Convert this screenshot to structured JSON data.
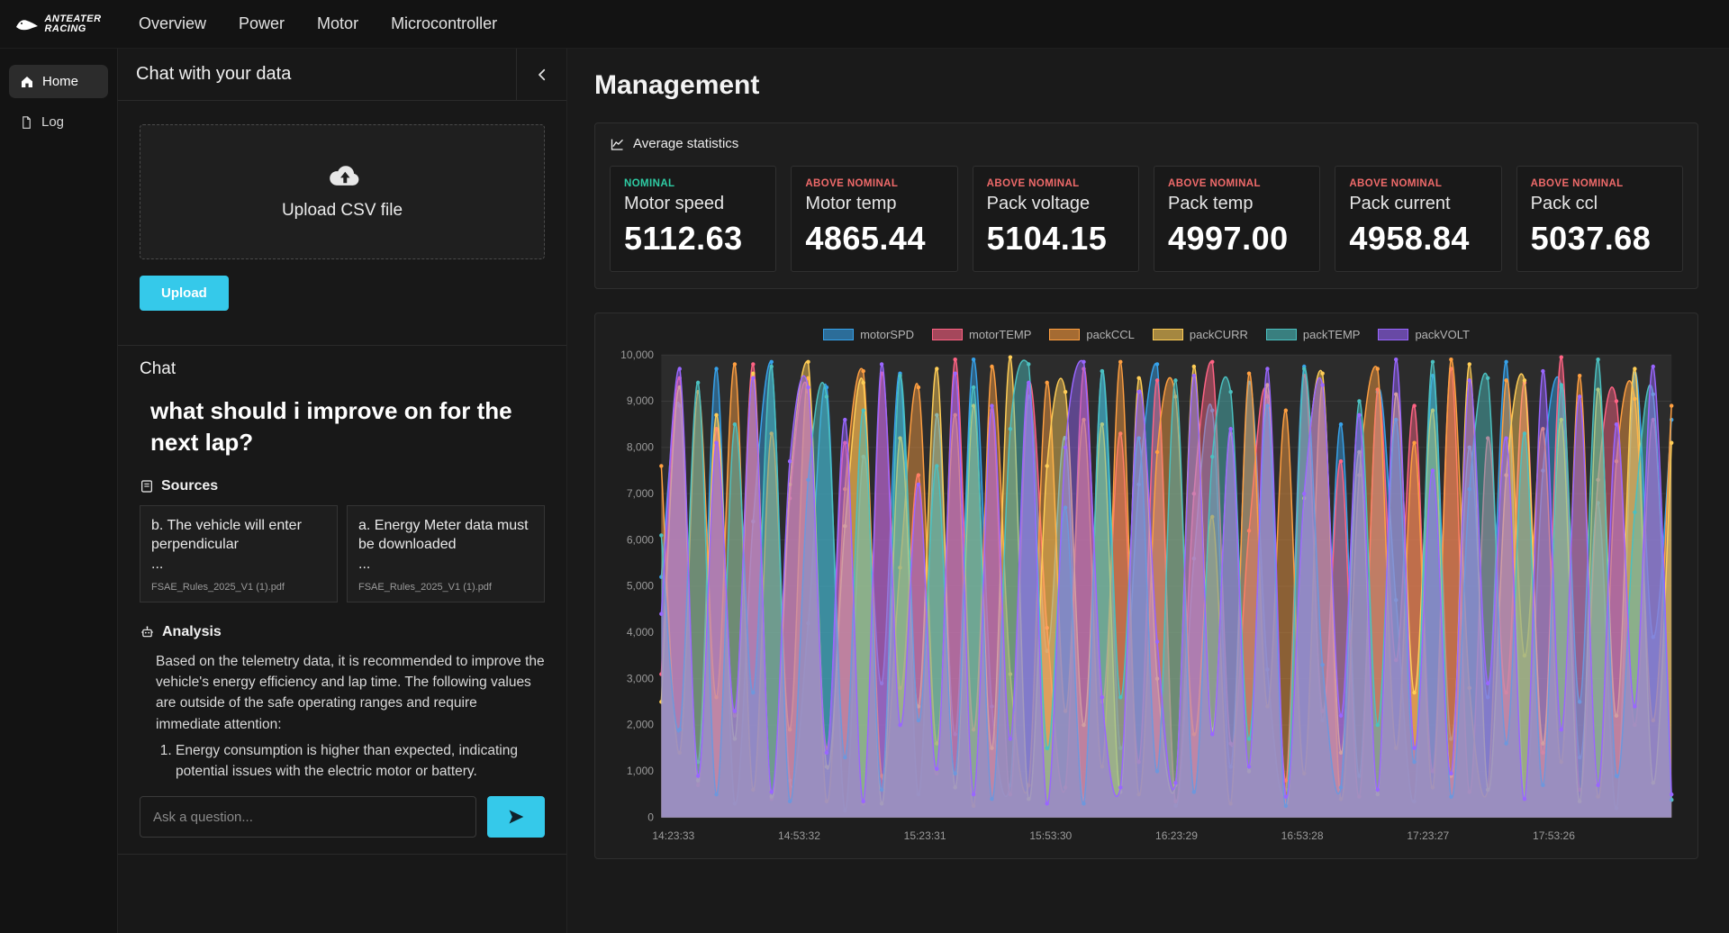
{
  "navbar": {
    "brand": {
      "line1": "ANTEATER",
      "line2": "RACING"
    },
    "items": [
      "Overview",
      "Power",
      "Motor",
      "Microcontroller"
    ]
  },
  "sidebar": {
    "items": [
      {
        "label": "Home"
      },
      {
        "label": "Log"
      }
    ]
  },
  "chat_panel": {
    "title": "Chat with your data",
    "upload": {
      "dropzone_label": "Upload CSV file",
      "button_label": "Upload"
    },
    "chat": {
      "heading": "Chat",
      "question": "what should i improve on for the next lap?",
      "sources_label": "Sources",
      "sources": [
        {
          "quote": "b. The vehicle will enter perpendicular",
          "more": "...",
          "file": "FSAE_Rules_2025_V1 (1).pdf"
        },
        {
          "quote": "a. Energy Meter data must be downloaded",
          "more": "...",
          "file": "FSAE_Rules_2025_V1 (1).pdf"
        }
      ],
      "analysis_label": "Analysis",
      "analysis_text": "Based on the telemetry data, it is recommended to improve the vehicle's energy efficiency and lap time. The following values are outside of the safe operating ranges and require immediate attention:",
      "analysis_list": [
        "Energy consumption is higher than expected, indicating potential issues with the electric motor or battery."
      ],
      "input_placeholder": "Ask a question..."
    }
  },
  "main": {
    "title": "Management",
    "stats": {
      "header": "Average statistics",
      "cards": [
        {
          "status": "NOMINAL",
          "status_color": "#2ecca4",
          "label": "Motor speed",
          "value": "5112.63"
        },
        {
          "status": "ABOVE NOMINAL",
          "status_color": "#ef6a6a",
          "label": "Motor temp",
          "value": "4865.44"
        },
        {
          "status": "ABOVE NOMINAL",
          "status_color": "#ef6a6a",
          "label": "Pack voltage",
          "value": "5104.15"
        },
        {
          "status": "ABOVE NOMINAL",
          "status_color": "#ef6a6a",
          "label": "Pack temp",
          "value": "4997.00"
        },
        {
          "status": "ABOVE NOMINAL",
          "status_color": "#ef6a6a",
          "label": "Pack current",
          "value": "4958.84"
        },
        {
          "status": "ABOVE NOMINAL",
          "status_color": "#ef6a6a",
          "label": "Pack ccl",
          "value": "5037.68"
        }
      ]
    }
  },
  "chart_data": {
    "type": "area",
    "title": "",
    "xlabel": "",
    "ylabel": "",
    "ylim": [
      0,
      10000
    ],
    "y_step": 1000,
    "grid": true,
    "legend_position": "top",
    "x_labels": [
      "14:23:33",
      "14:53:32",
      "15:23:31",
      "15:53:30",
      "16:23:29",
      "16:53:28",
      "17:23:27",
      "17:53:26"
    ],
    "series": [
      {
        "name": "motorSPD",
        "color": "#36a2eb",
        "values": [
          5200,
          8900,
          1200,
          9700,
          300,
          6400,
          9850,
          800,
          4200,
          9300,
          150,
          7800,
          2900,
          9600,
          500,
          8700,
          1800,
          9900,
          2400,
          700,
          9100,
          3600,
          8200,
          400,
          9650,
          1500,
          7200,
          9800,
          250,
          5600,
          8800,
          1100,
          9400,
          3200,
          600,
          9750,
          2100,
          8500,
          900,
          9200,
          4700,
          350,
          9550,
          1700,
          8000,
          2600,
          9850,
          450,
          7500,
          9300,
          1300,
          6800,
          200,
          9600,
          3900,
          8600
        ]
      },
      {
        "name": "motorTEMP",
        "color": "#ff6384",
        "values": [
          3100,
          9500,
          700,
          8400,
          2200,
          9800,
          400,
          6900,
          9200,
          1500,
          8100,
          300,
          9600,
          2800,
          7400,
          950,
          9900,
          1900,
          8800,
          500,
          9350,
          4100,
          650,
          9700,
          2500,
          8300,
          1200,
          9450,
          350,
          7000,
          9850,
          1600,
          6200,
          9100,
          800,
          9550,
          2300,
          7700,
          450,
          9250,
          3400,
          8900,
          1000,
          9700,
          550,
          8200,
          2700,
          9400,
          1400,
          9950,
          600,
          7300,
          9000,
          2000,
          8600,
          380
        ]
      },
      {
        "name": "packCCL",
        "color": "#ff9f40",
        "values": [
          7600,
          1400,
          9200,
          2600,
          9800,
          600,
          8300,
          1900,
          9500,
          350,
          7100,
          9650,
          900,
          5400,
          9300,
          1600,
          8700,
          250,
          9750,
          3100,
          700,
          9400,
          2300,
          8600,
          1100,
          9850,
          500,
          7900,
          9100,
          1800,
          6500,
          300,
          9600,
          2400,
          8800,
          950,
          9350,
          400,
          7400,
          9700,
          1500,
          8100,
          650,
          9900,
          2800,
          600,
          9450,
          3500,
          8400,
          1200,
          9550,
          450,
          7700,
          9050,
          2100,
          8900
        ]
      },
      {
        "name": "packCURR",
        "color": "#ffcd56",
        "values": [
          2500,
          9300,
          800,
          8700,
          1700,
          9600,
          450,
          7200,
          9850,
          1100,
          6300,
          9400,
          300,
          8200,
          2400,
          9700,
          650,
          8900,
          1500,
          9950,
          400,
          7600,
          9200,
          2000,
          8500,
          550,
          9500,
          3000,
          700,
          9750,
          1900,
          8300,
          1000,
          9350,
          250,
          6900,
          9600,
          1400,
          7900,
          500,
          9150,
          2700,
          8800,
          900,
          9800,
          600,
          7400,
          9450,
          1600,
          8600,
          350,
          9250,
          2200,
          9700,
          750,
          8100
        ]
      },
      {
        "name": "packTEMP",
        "color": "#4bc0c0",
        "values": [
          6100,
          1900,
          9400,
          500,
          8500,
          2700,
          9750,
          350,
          7300,
          9100,
          1300,
          8800,
          600,
          9550,
          2100,
          7600,
          950,
          9300,
          400,
          8400,
          9800,
          1500,
          6700,
          300,
          9650,
          2600,
          8200,
          1000,
          9450,
          550,
          7800,
          9200,
          1700,
          8900,
          250,
          9700,
          3300,
          650,
          9000,
          2000,
          8600,
          1200,
          9850,
          450,
          7100,
          9500,
          1600,
          8300,
          700,
          9350,
          2500,
          9900,
          900,
          6600,
          9150,
          380
        ]
      },
      {
        "name": "packVOLT",
        "color": "#9966ff",
        "values": [
          4400,
          9700,
          900,
          8100,
          2300,
          9500,
          550,
          7700,
          9300,
          1400,
          8600,
          350,
          9800,
          2000,
          7200,
          1050,
          9600,
          500,
          8900,
          1700,
          9400,
          300,
          8000,
          9850,
          2600,
          650,
          9200,
          3800,
          750,
          9550,
          1800,
          8400,
          1100,
          9700,
          450,
          7000,
          9350,
          2200,
          8700,
          600,
          9900,
          1500,
          7500,
          950,
          9450,
          2900,
          8200,
          400,
          9650,
          1900,
          9100,
          700,
          8500,
          2400,
          9750,
          500
        ]
      }
    ]
  }
}
